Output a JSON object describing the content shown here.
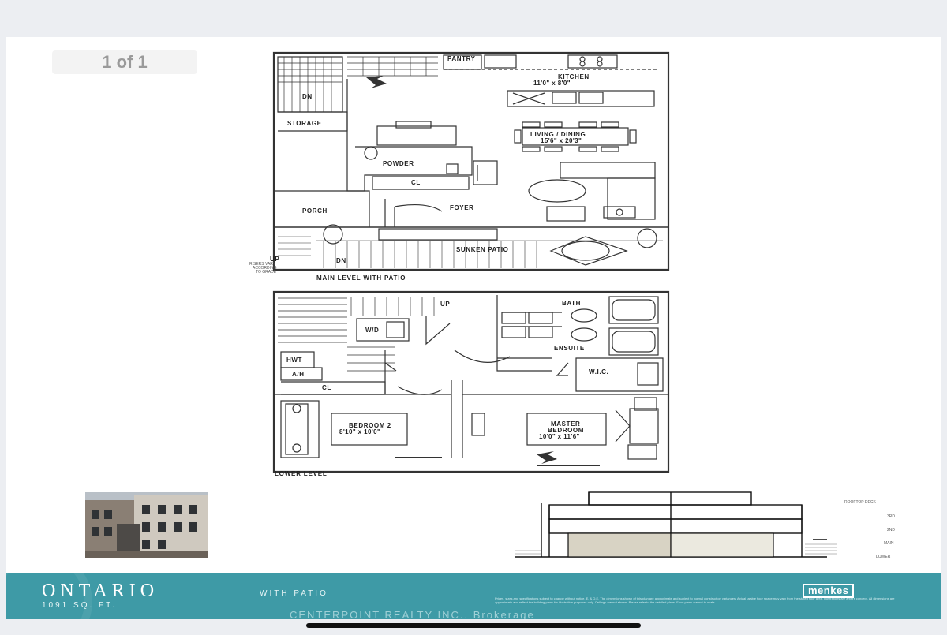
{
  "viewer": {
    "page_indicator": "1 of 1"
  },
  "main_level": {
    "caption": "MAIN LEVEL WITH PATIO",
    "rooms": {
      "pantry": "PANTRY",
      "kitchen": "KITCHEN",
      "kitchen_dim": "11'0\" x 8'0\"",
      "living": "LIVING / DINING",
      "living_dim": "15'6\" x 20'3\"",
      "storage": "STORAGE",
      "powder": "POWDER",
      "cl": "CL",
      "porch": "PORCH",
      "foyer": "FOYER",
      "sunken_patio": "SUNKEN PATIO",
      "dn_top": "DN",
      "dn_bottom": "DN",
      "up": "UP",
      "risers_note": [
        "RISERS VARY",
        "ACCORDING",
        "TO GRADE"
      ]
    }
  },
  "lower_level": {
    "caption": "LOWER LEVEL",
    "rooms": {
      "up": "UP",
      "bath": "BATH",
      "wd": "W/D",
      "ensuite": "ENSUITE",
      "hwt": "HWT",
      "ah": "A/H",
      "wic": "W.I.C.",
      "cl": "CL",
      "bedroom2": "BEDROOM 2",
      "bedroom2_dim": "8'10\" x 10'0\"",
      "master_line1": "MASTER",
      "master_line2": "BEDROOM",
      "master_dim": "10'0\" x 11'6\""
    }
  },
  "section": {
    "levels": [
      "ROOFTOP DECK",
      "3RD",
      "2ND",
      "MAIN",
      "LOWER"
    ]
  },
  "footer": {
    "title": "ONTARIO",
    "subtitle": "WITH PATIO",
    "area": "1091 SQ. FT.",
    "brokerage": "CENTERPOINT REALTY INC., Brokerage",
    "logo": "menkes",
    "disclaimer": "Prices, sizes and specifications subject to change without notice. E. & O.E. The dimensions shown of this plan are approximate and subject to normal construction variances. Actual usable floor space may vary from the stated floor area. Illustrations are artist's concept. All dimensions are approximate and reflect the building plans for illustration purposes only. Ceilings are not shown. Please refer to the detailed plans. Floor plans are not to scale.",
    "accent_color": "#3e9aa6"
  }
}
